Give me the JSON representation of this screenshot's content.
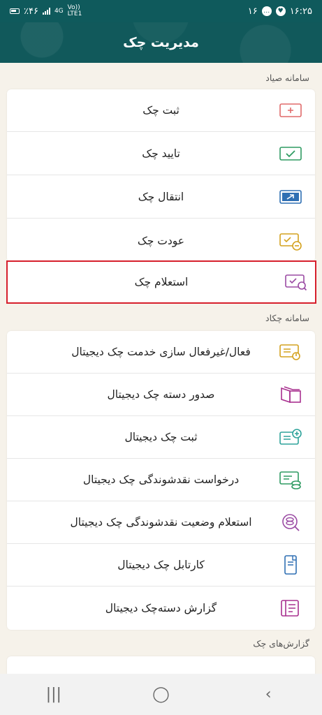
{
  "status_bar": {
    "time": "۱۶:۲۵",
    "notification_count": "۱۶",
    "battery": "٪۴۶",
    "network_top": "4G",
    "network_bottom": "LTE1",
    "volte": "Vo))"
  },
  "header": {
    "title": "مدیریت چک"
  },
  "sections": [
    {
      "title": "سامانه صیاد",
      "items": [
        {
          "label": "ثبت چک",
          "icon": "register-check-icon",
          "color": "#e06a6a"
        },
        {
          "label": "تایید چک",
          "icon": "confirm-check-icon",
          "color": "#2f9b62"
        },
        {
          "label": "انتقال چک",
          "icon": "transfer-check-icon",
          "color": "#2f6fb3"
        },
        {
          "label": "عودت چک",
          "icon": "return-check-icon",
          "color": "#d4a21f"
        },
        {
          "label": "استعلام چک",
          "icon": "inquiry-check-icon",
          "color": "#9a4aa3",
          "highlighted": true
        }
      ]
    },
    {
      "title": "سامانه چکاد",
      "items": [
        {
          "label": "فعال/غیرفعال سازی خدمت چک دیجیتال",
          "icon": "activate-digital-check-icon",
          "color": "#d4a21f"
        },
        {
          "label": "صدور دسته چک دیجیتال",
          "icon": "issue-checkbook-icon",
          "color": "#a8308f"
        },
        {
          "label": "ثبت چک دیجیتال",
          "icon": "register-digital-check-icon",
          "color": "#2fa39b"
        },
        {
          "label": "درخواست نقدشوندگی چک دیجیتال",
          "icon": "liquidity-request-icon",
          "color": "#2f9b62"
        },
        {
          "label": "استعلام وضعیت نقدشوندگی چک دیجیتال",
          "icon": "liquidity-status-icon",
          "color": "#9a4aa3"
        },
        {
          "label": "کارتابل چک دیجیتال",
          "icon": "cartable-icon",
          "color": "#2f6fb3"
        },
        {
          "label": "گزارش دسته‌چک دیجیتال",
          "icon": "checkbook-report-icon",
          "color": "#a8308f"
        }
      ]
    },
    {
      "title": "گزارش‌های چک",
      "items": []
    }
  ],
  "navbar": {
    "recents": "|||",
    "home": "◯",
    "back": "‹"
  }
}
